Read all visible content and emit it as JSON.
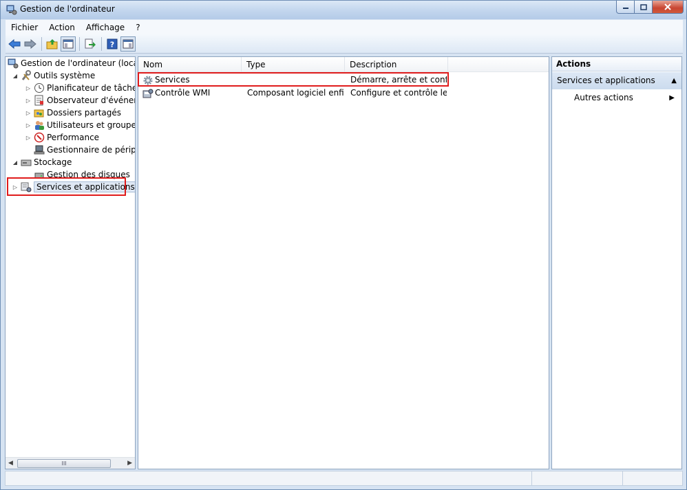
{
  "window": {
    "title": "Gestion de l'ordinateur"
  },
  "menu": [
    "Fichier",
    "Action",
    "Affichage",
    "?"
  ],
  "toolbar": {
    "buttons": [
      "back-arrow-icon",
      "forward-arrow-icon",
      "up-folder-icon",
      "show-hide-tree-icon",
      "export-list-icon",
      "help-icon",
      "show-hide-action-pane-icon"
    ]
  },
  "tree": {
    "root": "Gestion de l'ordinateur (local)",
    "outils": "Outils système",
    "planificateur": "Planificateur de tâches",
    "observateur": "Observateur d'événeme",
    "dossiers": "Dossiers partagés",
    "utilisateurs": "Utilisateurs et groupes l",
    "performance": "Performance",
    "gestionnaire": "Gestionnaire de périphé",
    "stockage": "Stockage",
    "disques": "Gestion des disques",
    "services_apps": "Services et applications"
  },
  "list": {
    "columns": {
      "nom": "Nom",
      "type": "Type",
      "description": "Description"
    },
    "rows": [
      {
        "nom": "Services",
        "type": "",
        "description": "Démarre, arrête et confi..."
      },
      {
        "nom": "Contrôle WMI",
        "type": "Composant logiciel enfi...",
        "description": "Configure et contrôle le ..."
      }
    ]
  },
  "actions": {
    "header": "Actions",
    "section": "Services et applications",
    "item": "Autres actions"
  },
  "scrollbar": {
    "thumb_grip": "III"
  },
  "colors": {
    "highlight_box": "#e01b1b",
    "selection": "#dfe8f4"
  }
}
